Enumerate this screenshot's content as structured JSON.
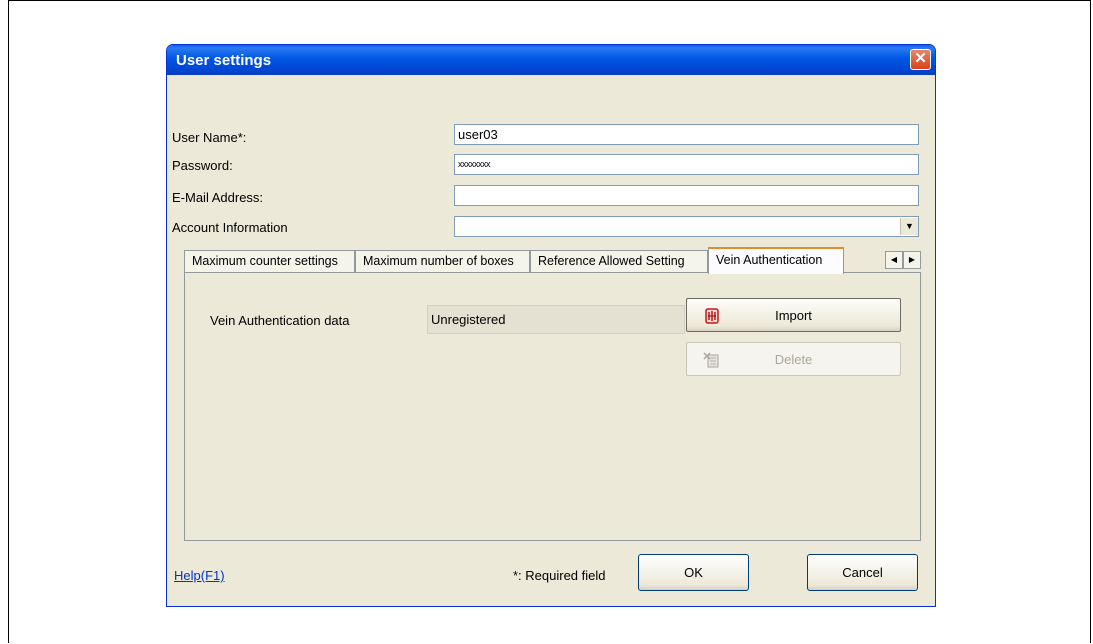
{
  "dialog": {
    "title": "User settings",
    "close_glyph": "✕"
  },
  "fields": {
    "user_name_label": "User Name*:",
    "user_name_value": "user03",
    "password_label": "Password:",
    "password_value": "xxxxxxxx",
    "email_label": "E-Mail Address:",
    "email_value": "",
    "account_label": "Account Information",
    "account_value": ""
  },
  "tabs": [
    {
      "label": "Maximum counter settings"
    },
    {
      "label": "Maximum number of boxes"
    },
    {
      "label": "Reference Allowed Setting"
    },
    {
      "label": "Vein Authentication"
    }
  ],
  "active_tab": "Vein Authentication",
  "tab_scroll": {
    "left": "◀",
    "right": "▶"
  },
  "panel": {
    "data_label": "Vein Authentication data",
    "status_value": "Unregistered",
    "import_label": "Import",
    "delete_label": "Delete",
    "import_icon": "vein-import-icon",
    "delete_icon": "delete-icon"
  },
  "footer": {
    "help_label": "Help(F1)",
    "required_note": "*: Required field",
    "ok_label": "OK",
    "cancel_label": "Cancel"
  },
  "colors": {
    "titlebar": "#0055e5",
    "dialog_bg": "#ece9d8",
    "active_tab_accent": "#e68b2c",
    "close_button": "#d8431e",
    "link": "#0033cc"
  }
}
